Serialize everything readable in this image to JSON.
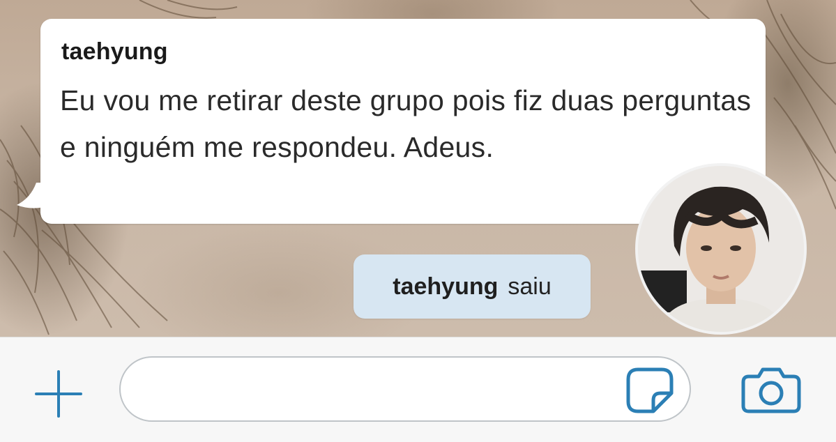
{
  "chat": {
    "incoming_message": {
      "sender": "taehyung",
      "text": "Eu vou me retirar deste grupo pois fiz duas perguntas e ninguém me respondeu. Adeus."
    },
    "system_event": {
      "name": "taehyung",
      "action": "saiu"
    },
    "avatar_icon": "profile-photo"
  },
  "composer": {
    "input_value": "",
    "icons": {
      "add": "plus-icon",
      "sticker": "sticker-icon",
      "camera": "camera-icon"
    }
  },
  "colors": {
    "bubble_background": "#ffffff",
    "system_pill_background": "#d7e6f2",
    "icon_accent": "#2b7fb5",
    "composer_background": "#f7f7f7"
  }
}
